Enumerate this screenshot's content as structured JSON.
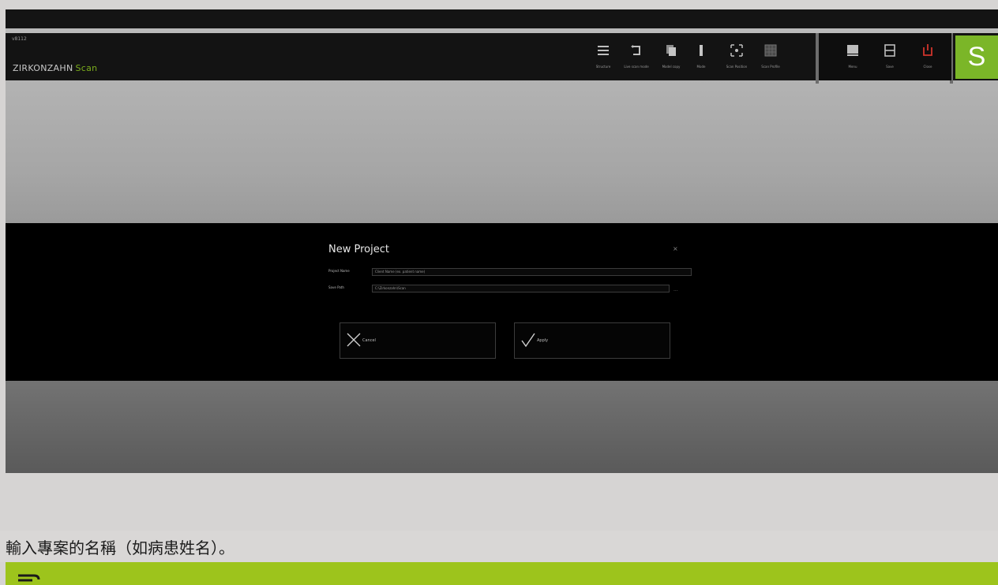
{
  "app": {
    "version": "v8112",
    "brand_primary": "ZIRKONZAHN",
    "brand_secondary": "Scan",
    "scan_button_label": "S"
  },
  "toolbar": {
    "items": [
      {
        "icon": "list-icon",
        "label": "Structure"
      },
      {
        "icon": "undo-icon",
        "label": "Live scan mode"
      },
      {
        "icon": "copy-icon",
        "label": "Model copy"
      },
      {
        "icon": "bar-icon",
        "label": "Mode"
      },
      {
        "icon": "crosshair-icon",
        "label": "Scan Position"
      },
      {
        "icon": "grid-icon",
        "label": "Scan Profile"
      }
    ],
    "right_items": [
      {
        "icon": "monitor-icon",
        "label": "Menu"
      },
      {
        "icon": "save-icon",
        "label": "Save"
      },
      {
        "icon": "power-icon",
        "label": "Close"
      }
    ]
  },
  "dialog": {
    "title": "New Project",
    "close_glyph": "×",
    "project_name_label": "Project Name",
    "project_name_value": "Client Name (ex. patient name)",
    "save_path_label": "Save Path",
    "save_path_value": "C:\\Zirkonzahn\\Scan",
    "browse_glyph": "...",
    "cancel_label": "Cancel",
    "apply_label": "Apply"
  },
  "caption": {
    "text": "輸入專案的名稱（如病患姓名）。"
  },
  "colors": {
    "accent_green": "#7bb628",
    "footer_green": "#9dc41c",
    "close_red": "#d0342c"
  }
}
